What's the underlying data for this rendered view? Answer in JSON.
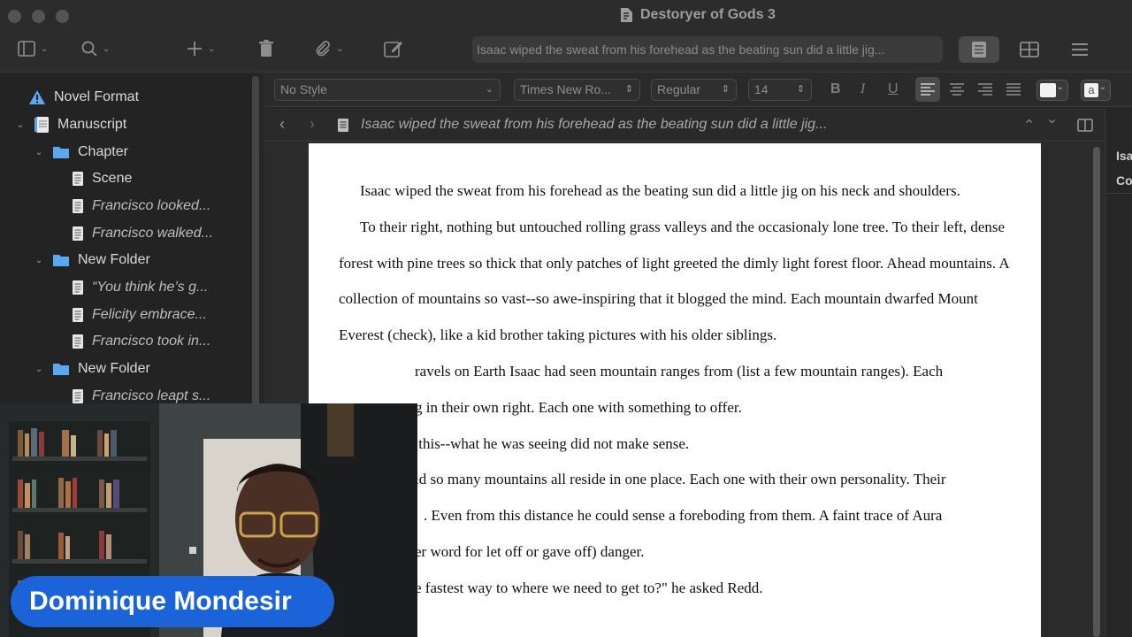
{
  "window": {
    "title": "Destoryer of Gods 3"
  },
  "toolbar": {
    "quick_search_text": "Isaac wiped the sweat from his forehead as the beating sun did a little jig..."
  },
  "binder": {
    "items": [
      {
        "label": "Novel Format",
        "italic": false
      },
      {
        "label": "Manuscript",
        "italic": false
      },
      {
        "label": "Chapter",
        "italic": false
      },
      {
        "label": "Scene",
        "italic": false
      },
      {
        "label": "Francisco looked...",
        "italic": true
      },
      {
        "label": "Francisco walked...",
        "italic": true
      },
      {
        "label": "New Folder",
        "italic": false
      },
      {
        "label": "“You think he’s g...",
        "italic": true
      },
      {
        "label": "Felicity embrace...",
        "italic": true
      },
      {
        "label": "Francisco took in...",
        "italic": true
      },
      {
        "label": "New Folder",
        "italic": false
      },
      {
        "label": "Francisco leapt s...",
        "italic": true
      }
    ]
  },
  "format_bar": {
    "style": "No Style",
    "font": "Times New Ro...",
    "weight": "Regular",
    "size": "14",
    "bold": "B",
    "italic": "I",
    "underline": "U",
    "highlight_swatch": "a"
  },
  "header": {
    "title": "Isaac wiped the sweat from his forehead as the beating sun did a little jig..."
  },
  "editor": {
    "paragraphs": [
      "Isaac wiped the sweat from his forehead as the beating sun did a little jig on his neck and shoulders.",
      "To their right, nothing but untouched rolling grass valleys and the occasionaly lone tree. To their left, dense forest with pine trees so thick that only patches of light greeted the dimly light forest floor. Ahead mountains. A collection of mountains so vast--so awe-inspiring that it blogged the mind. Each mountain dwarfed Mount Everest (check), like a kid brother taking pictures with his older siblings.",
      "ravels on Earth Isaac had seen mountain ranges from (list a few mountain ranges). Each",
      "g in their own right. Each one with something to offer.",
      ".this--what he was seeing did not make sense.",
      "ld so many mountains all reside in one place. Each one with their own personality. Their",
      ". Even from this distance he could sense a foreboding from them. A faint trace of Aura",
      "er word for let off or gave off) danger.",
      "e fastest way to where we need to get to?\" he asked Redd."
    ]
  },
  "inspector": {
    "line1": "Isa",
    "line2": "Co"
  },
  "webcam": {
    "name": "Dominique Mondesir"
  },
  "colors": {
    "folder": "#5aa9f0",
    "warning": "#5aa9f0",
    "name_tag": "#1a63d8"
  }
}
